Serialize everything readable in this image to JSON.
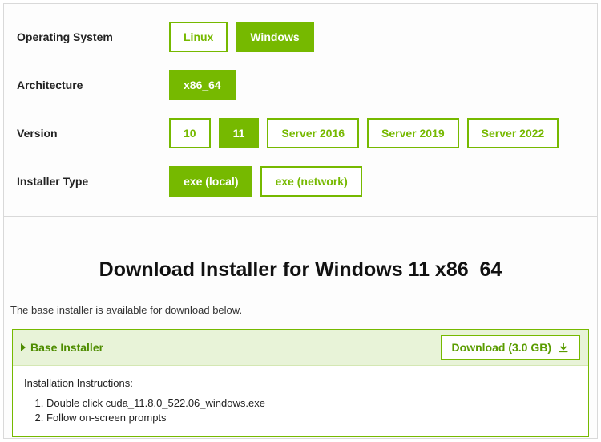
{
  "colors": {
    "accent": "#76b900"
  },
  "selectors": {
    "os": {
      "label": "Operating System",
      "options": [
        "Linux",
        "Windows"
      ],
      "selected_index": 1
    },
    "arch": {
      "label": "Architecture",
      "options": [
        "x86_64"
      ],
      "selected_index": 0
    },
    "version": {
      "label": "Version",
      "options": [
        "10",
        "11",
        "Server 2016",
        "Server 2019",
        "Server 2022"
      ],
      "selected_index": 1
    },
    "installer": {
      "label": "Installer Type",
      "options": [
        "exe (local)",
        "exe (network)"
      ],
      "selected_index": 0
    }
  },
  "download": {
    "title": "Download Installer for Windows 11 x86_64",
    "subtitle": "The base installer is available for download below.",
    "base_installer": {
      "label": "Base Installer",
      "download_label": "Download (3.0 GB)",
      "size": "3.0 GB",
      "instructions_title": "Installation Instructions:",
      "steps": [
        "Double click cuda_11.8.0_522.06_windows.exe",
        "Follow on-screen prompts"
      ]
    }
  }
}
